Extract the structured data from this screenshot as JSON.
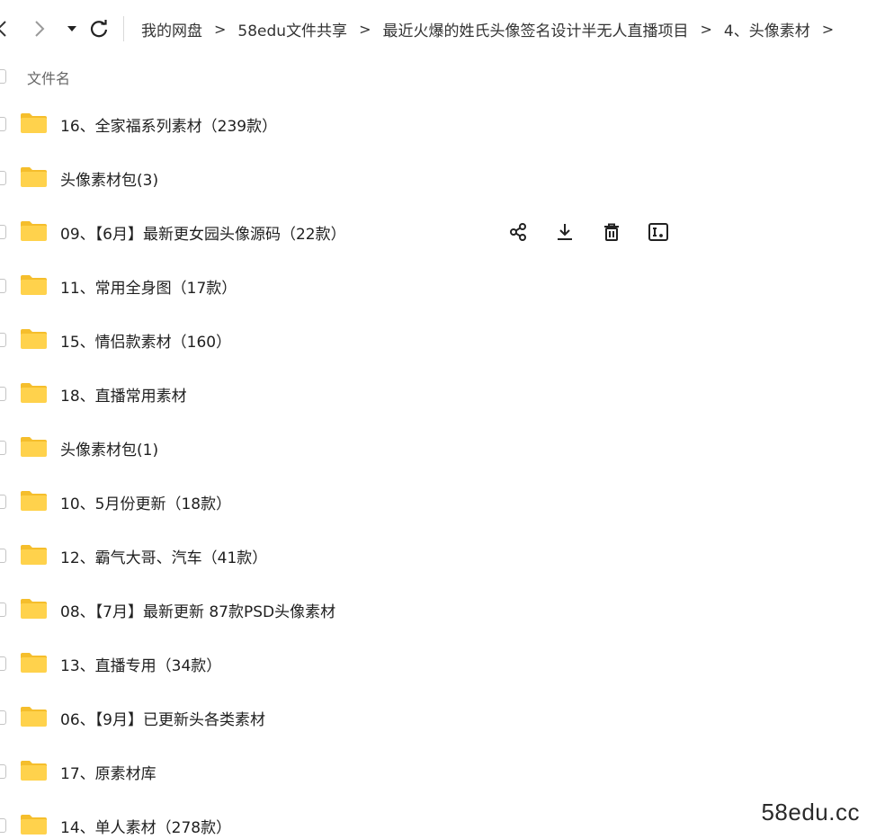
{
  "nav": {
    "back_icon": "chevron-left-icon",
    "forward_icon": "chevron-right-icon",
    "dropdown_icon": "caret-down-icon",
    "refresh_icon": "refresh-icon"
  },
  "breadcrumb": {
    "items": [
      "我的网盘",
      "58edu文件共享",
      "最近火爆的姓氏头像签名设计半无人直播项目",
      "4、头像素材"
    ],
    "separator": ">"
  },
  "list": {
    "column_name": "文件名",
    "rows": [
      {
        "name": "16、全家福系列素材（239款）"
      },
      {
        "name": "头像素材包(3)"
      },
      {
        "name": "09、【6月】最新更女园头像源码（22款）"
      },
      {
        "name": "11、常用全身图（17款）"
      },
      {
        "name": "15、情侣款素材（160）"
      },
      {
        "name": "18、直播常用素材"
      },
      {
        "name": "头像素材包(1)"
      },
      {
        "name": "10、5月份更新（18款）"
      },
      {
        "name": "12、霸气大哥、汽车（41款）"
      },
      {
        "name": "08、【7月】最新更新 87款PSD头像素材"
      },
      {
        "name": "13、直播专用（34款）"
      },
      {
        "name": "06、【9月】已更新头各类素材"
      },
      {
        "name": "17、原素材库"
      },
      {
        "name": "14、单人素材（278款）"
      }
    ],
    "hovered_row_actions": [
      "share-icon",
      "download-icon",
      "delete-icon",
      "rename-icon"
    ]
  },
  "watermark": "58edu.cc",
  "colors": {
    "folder": "#FFD24C",
    "folder_tab": "#F5BE2C",
    "text": "#1f1f1f",
    "muted": "#666666"
  }
}
